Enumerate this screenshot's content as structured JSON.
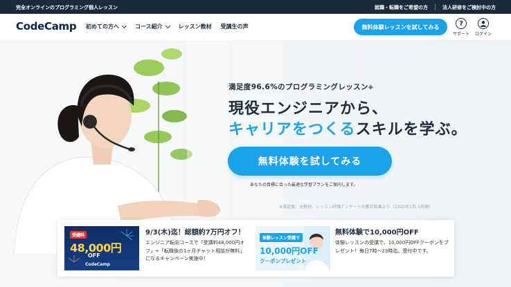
{
  "topbar": {
    "tagline": "完全オンラインのプログラミング個人レッスン",
    "links": [
      "就職・転職をご希望の方",
      "法人研修をご検討中の方"
    ]
  },
  "header": {
    "logo_text": "CodeCamp",
    "nav": [
      {
        "label": "初めての方へ",
        "dropdown": true
      },
      {
        "label": "コース紹介",
        "dropdown": true
      },
      {
        "label": "レッスン教材",
        "dropdown": false
      },
      {
        "label": "受講生の声",
        "dropdown": false
      }
    ],
    "cta_label": "無料体験レッスンを試してみる",
    "support_label": "サポート",
    "login_label": "ログイン",
    "support_icon": "question-circle-icon",
    "login_icon": "user-circle-icon"
  },
  "hero": {
    "satisfaction": "満足度96.6%のプログラミングレッスン",
    "satisfaction_note": "※",
    "headline_line1": "現役エンジニアから、",
    "headline_accent": "キャリアをつくる",
    "headline_rest": "スキルを学ぶ。",
    "cta_label": "無料体験を試してみる",
    "cta_sub": "あなたの目標に合った最適な学習プランをご案内します。",
    "footnote": "※満足度：全教材、レッスン評価アンケートの集計結果より（2020年1月-3月期）"
  },
  "banners": [
    {
      "image_badge": "受講料",
      "image_amount": "48,000円",
      "image_off": "OFF",
      "image_brand": "CodeCamp",
      "title": "9/3(木)迄！総額約7万円オフ！",
      "text": "エンジニア転向コースで「受講料48,000円オフ」+「転職後の1ヶ月チャット相談が無料」になるキャンペーン実施中！"
    },
    {
      "image_badge": "体験レッスン受講で",
      "image_amount": "10,000円OFF",
      "image_coupon": "クーポンプレゼント",
      "title": "無料体験で10,000円OFF",
      "text": "体験レッスンの受講で、10,000円OFFクーポンをプレゼント！毎日7時〜23時迄。受付中です。"
    }
  ],
  "colors": {
    "brand_blue": "#1aa3e8",
    "navy": "#1b2a3a"
  }
}
